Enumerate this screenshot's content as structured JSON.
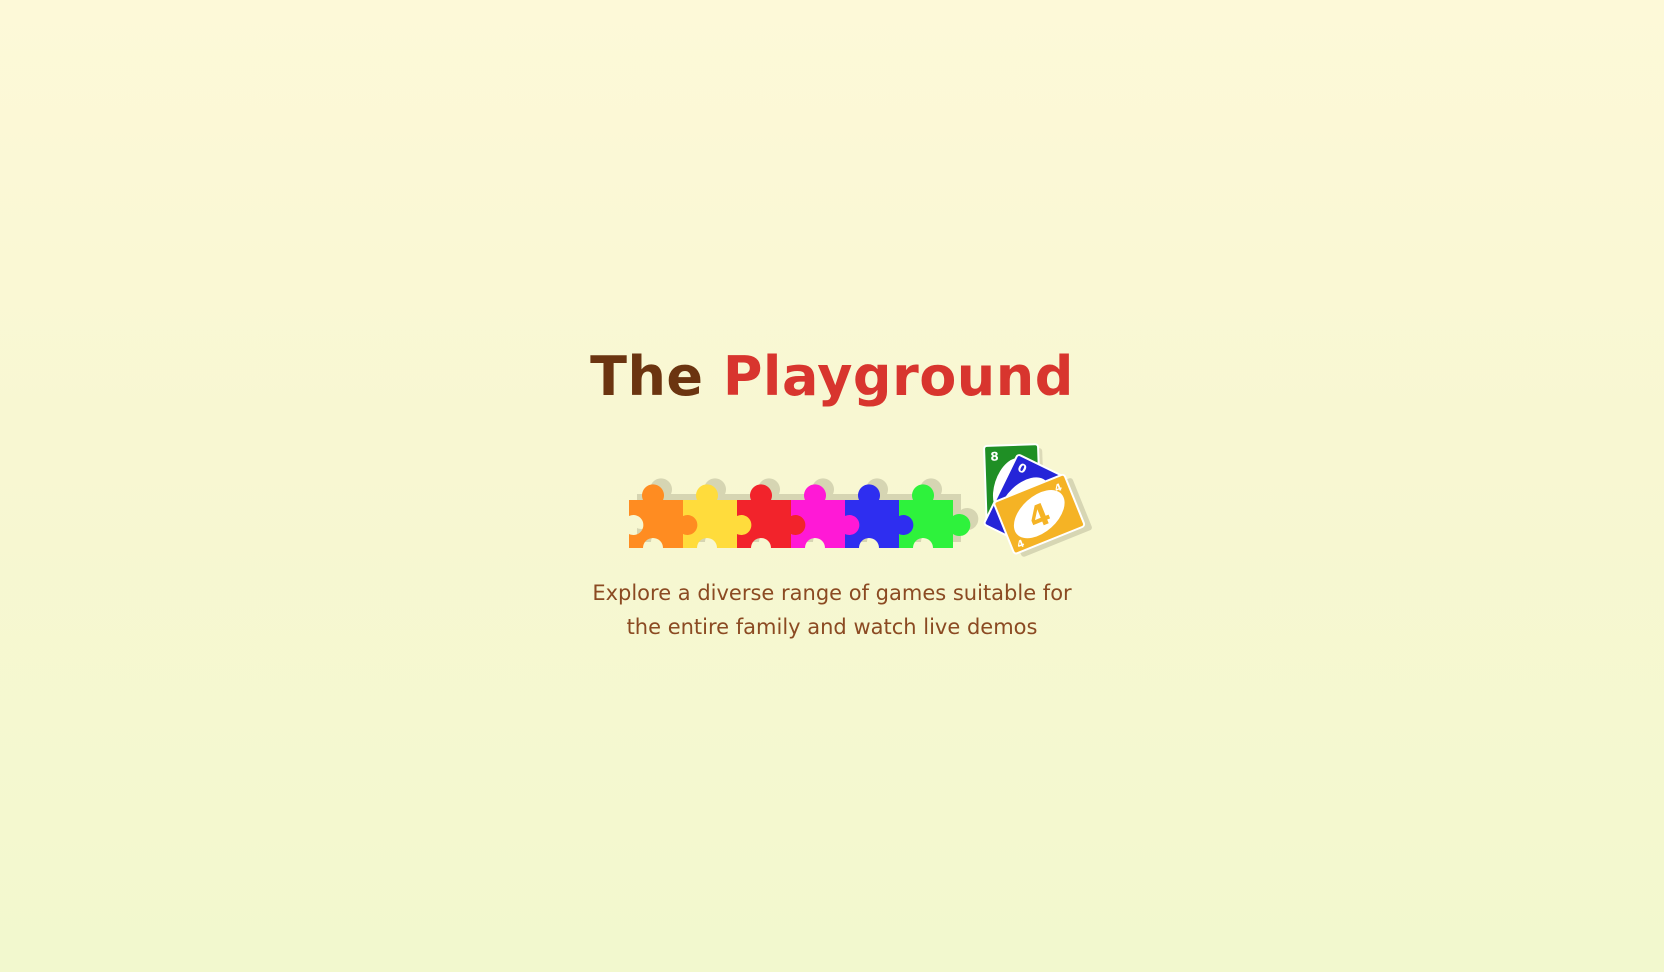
{
  "hero": {
    "title_word_1": "The",
    "title_word_2": "Playground",
    "tagline": "Explore a diverse range of games suitable for the entire family and watch live demos"
  },
  "logo": {
    "puzzle_colors": [
      "#ff8c21",
      "#ffdc3c",
      "#f2232b",
      "#ff19d6",
      "#2e2ef0",
      "#2ef23c"
    ],
    "cards": [
      {
        "color": "#1f8f25",
        "label": "8"
      },
      {
        "color": "#2525d8",
        "label": "0"
      },
      {
        "color": "#f5b325",
        "label": "4"
      }
    ]
  },
  "colors": {
    "title_dark": "#6b3410",
    "title_accent": "#d8352e",
    "tagline": "#8b4a22"
  }
}
